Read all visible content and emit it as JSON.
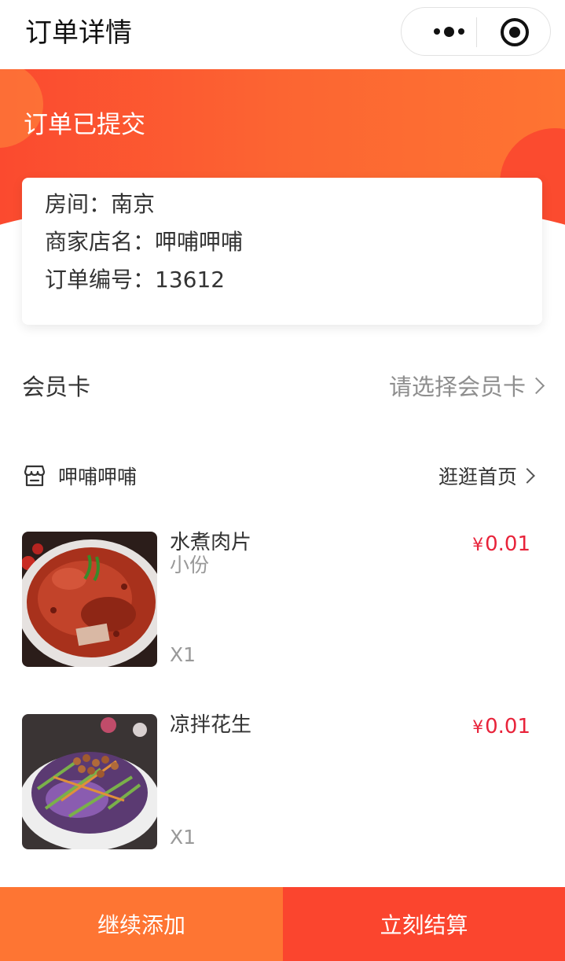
{
  "navbar": {
    "title": "订单详情",
    "more_icon": "more-dots-icon",
    "close_icon": "target-close-icon"
  },
  "banner": {
    "status": "订单已提交"
  },
  "order_info": {
    "room": "房间：南京",
    "merchant": "商家店名：呷哺呷哺",
    "order_no": "订单编号：13612"
  },
  "member_card": {
    "label": "会员卡",
    "placeholder": "请选择会员卡"
  },
  "shop": {
    "icon": "store-icon",
    "name": "呷哺呷哺",
    "home_link": "逛逛首页"
  },
  "products": [
    {
      "name": "水煮肉片",
      "spec": "小份",
      "qty": "X1",
      "currency": "¥",
      "price": "0.01"
    },
    {
      "name": "凉拌花生",
      "spec": "",
      "qty": "X1",
      "currency": "¥",
      "price": "0.01"
    }
  ],
  "bottom_bar": {
    "continue_label": "继续添加",
    "checkout_label": "立刻结算"
  },
  "colors": {
    "accent_orange": "#fe7533",
    "accent_red": "#fb452e",
    "price_red": "#e8233a"
  }
}
